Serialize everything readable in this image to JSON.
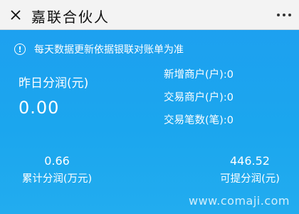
{
  "titlebar": {
    "title": "嘉联合伙人",
    "close_icon": "close-icon",
    "more_icon": "more-dots-icon"
  },
  "notice": {
    "icon": "info-icon",
    "text": "每天数据更新依据银联对账单为准"
  },
  "yesterday": {
    "label": "昨日分润(元)",
    "value": "0.00"
  },
  "stats": [
    {
      "label": "新增商户(户):",
      "value": "0"
    },
    {
      "label": "交易商户(户):",
      "value": "0"
    },
    {
      "label": "交易笔数(笔):",
      "value": "0"
    }
  ],
  "summary": {
    "total_value": "0.66",
    "total_label": "累计分润(万元)",
    "withdrawable_value": "446.52",
    "withdrawable_label": "可提分润(元)"
  },
  "watermark": "www.comaji.com",
  "colors": {
    "background": "#1ba6ee",
    "titlebar": "#f3f3f3",
    "text": "#ffffff"
  }
}
